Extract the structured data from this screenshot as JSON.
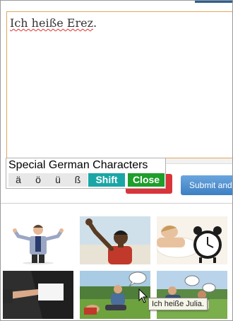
{
  "answer": {
    "text": "Ich heiße Erez",
    "period": "."
  },
  "keyboard": {
    "title": "Special German Characters",
    "chars": [
      "ä",
      "ö",
      "ü",
      "ß"
    ],
    "shift_label": "Shift",
    "close_label": "Close"
  },
  "submit_label": "Submit and",
  "tooltip": "Ich heiße Julia.",
  "colors": {
    "keyboard_shift": "#1aa6a6",
    "keyboard_close": "#1e9e2a",
    "submit": "#3d7fc3",
    "textarea_border": "#e0a85a"
  },
  "tiles": [
    {
      "name": "businessman-arms-open-image"
    },
    {
      "name": "man-waving-image"
    },
    {
      "name": "sleeping-alarm-clock-image"
    },
    {
      "name": "business-card-image"
    },
    {
      "name": "man-speech-bubble-park-image"
    },
    {
      "name": "couple-speech-bubble-park-image"
    }
  ]
}
